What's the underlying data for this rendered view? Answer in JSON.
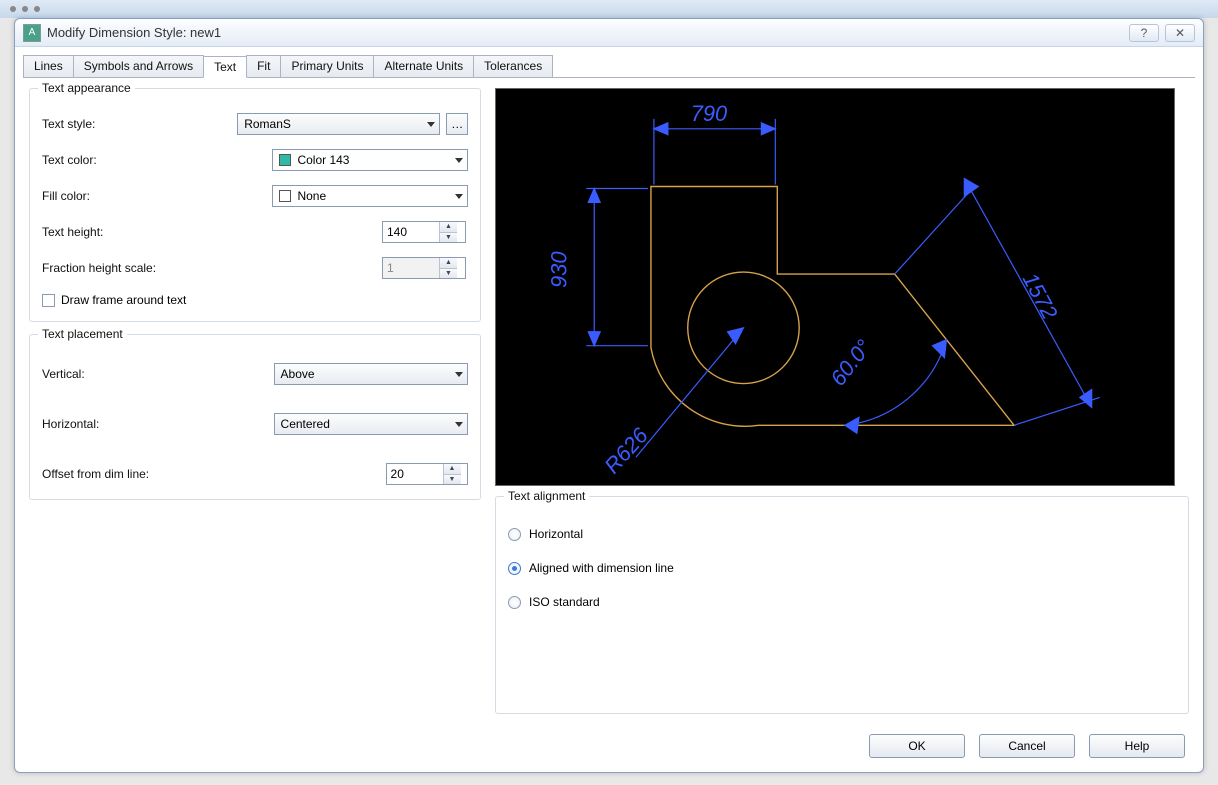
{
  "window": {
    "title": "Modify Dimension Style: new1"
  },
  "tabs": [
    "Lines",
    "Symbols and Arrows",
    "Text",
    "Fit",
    "Primary Units",
    "Alternate Units",
    "Tolerances"
  ],
  "active_tab": "Text",
  "appearance": {
    "group_title": "Text appearance",
    "text_style_label": "Text style:",
    "text_style_value": "RomanS",
    "text_color_label": "Text color:",
    "text_color_value": "Color 143",
    "text_color_hex": "#2fb9a8",
    "fill_color_label": "Fill color:",
    "fill_color_value": "None",
    "text_height_label": "Text height:",
    "text_height_value": "140",
    "fraction_scale_label": "Fraction height scale:",
    "fraction_scale_value": "1",
    "draw_frame_label": "Draw frame around text",
    "draw_frame_checked": false
  },
  "placement": {
    "group_title": "Text placement",
    "vertical_label": "Vertical:",
    "vertical_value": "Above",
    "horizontal_label": "Horizontal:",
    "horizontal_value": "Centered",
    "offset_label": "Offset from dim line:",
    "offset_value": "20"
  },
  "alignment": {
    "group_title": "Text alignment",
    "options": [
      "Horizontal",
      "Aligned with dimension line",
      "ISO standard"
    ],
    "selected": "Aligned with dimension line"
  },
  "preview": {
    "dims": {
      "top": "790",
      "left": "930",
      "radius": "R626",
      "angle": "60.0°",
      "diag": "1572"
    },
    "dim_color": "#3a5cff",
    "shape_color": "#d6a24a"
  },
  "footer": {
    "ok": "OK",
    "cancel": "Cancel",
    "help": "Help"
  }
}
